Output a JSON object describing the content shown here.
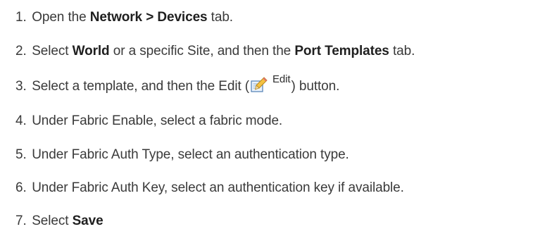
{
  "steps": [
    {
      "num": "1.",
      "a": "Open the ",
      "b1": "Network > Devices",
      "c": " tab."
    },
    {
      "num": "2.",
      "a": "Select ",
      "b1": "World",
      "c": " or a specific Site, and then the ",
      "b2": "Port Templates",
      "d": " tab."
    },
    {
      "num": "3.",
      "a": "Select a template, and then the Edit (",
      "button_label": "Edit",
      "button_icon": "edit-pencil-icon",
      "c": ") button."
    },
    {
      "num": "4.",
      "a": "Under Fabric Enable, select a fabric mode."
    },
    {
      "num": "5.",
      "a": "Under Fabric Auth Type, select an authentication type."
    },
    {
      "num": "6.",
      "a": "Under Fabric Auth Key, select an authentication key if available."
    },
    {
      "num": "7.",
      "a": "Select ",
      "b1": "Save"
    }
  ]
}
